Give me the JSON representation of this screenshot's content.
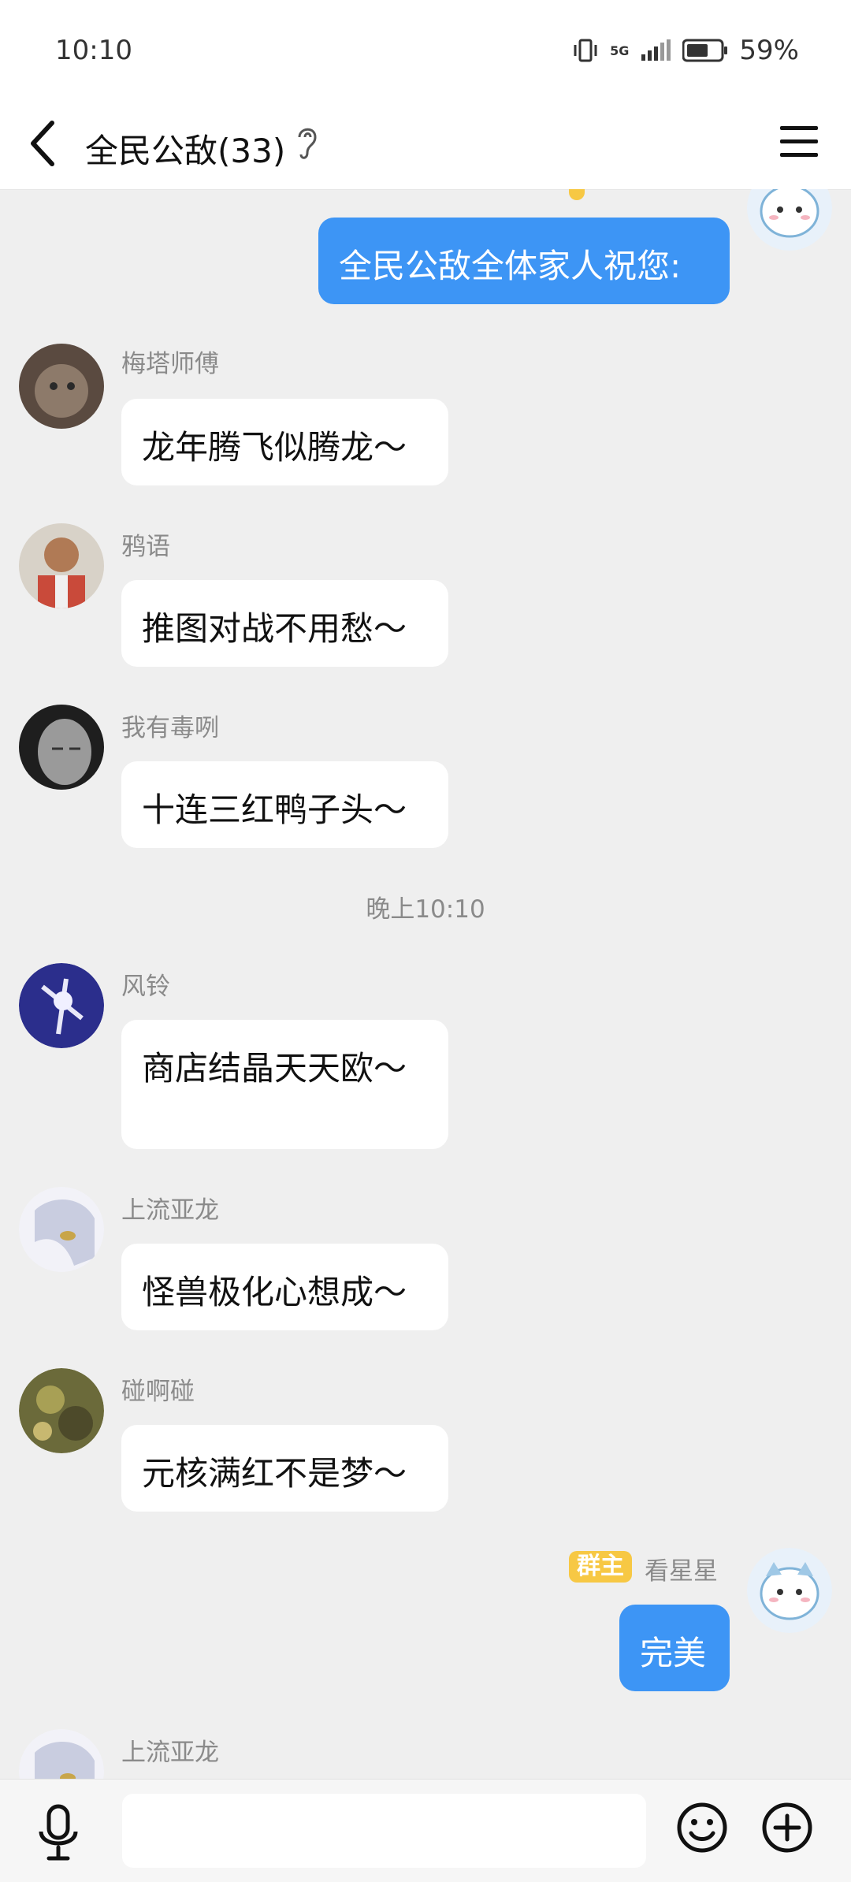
{
  "status_bar": {
    "time": "10:10",
    "network": "5G",
    "battery": "59%"
  },
  "header": {
    "title": "全民公敌(33)"
  },
  "chat": {
    "top_message": {
      "text": "全民公敌全体家人祝您:"
    },
    "messages": [
      {
        "sender": "梅塔师傅",
        "text": "龙年腾飞似腾龙～"
      },
      {
        "sender": "鸦语",
        "text": "推图对战不用愁～"
      },
      {
        "sender": "我有毒咧",
        "text": "十连三红鸭子头～"
      }
    ],
    "timestamp": "晚上10:10",
    "messages2": [
      {
        "sender": "风铃",
        "text": "商店结晶天天欧～"
      },
      {
        "sender": "上流亚龙",
        "text": "怪兽极化心想成～"
      },
      {
        "sender": "碰啊碰",
        "text": "元核满红不是梦～"
      }
    ],
    "owner_message": {
      "badge": "群主",
      "sender": "看星星",
      "text": "完美"
    },
    "last_sender": "上流亚龙"
  },
  "input": {
    "placeholder": ""
  },
  "colors": {
    "accent_blue": "#3d95f5",
    "badge_yellow": "#f7c844",
    "background": "#efefef"
  }
}
